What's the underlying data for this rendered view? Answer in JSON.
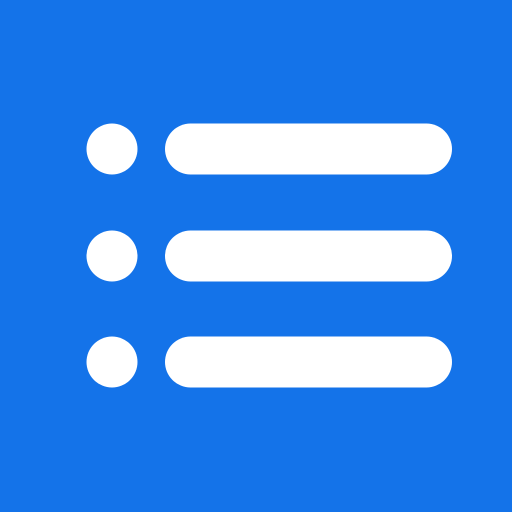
{
  "icon": {
    "semantic": "list-icon",
    "background_color": "#1473E9",
    "foreground_color": "#FFFFFF",
    "rows": [
      {
        "bullet": "bullet-dot",
        "line": "list-line"
      },
      {
        "bullet": "bullet-dot",
        "line": "list-line"
      },
      {
        "bullet": "bullet-dot",
        "line": "list-line"
      }
    ]
  }
}
